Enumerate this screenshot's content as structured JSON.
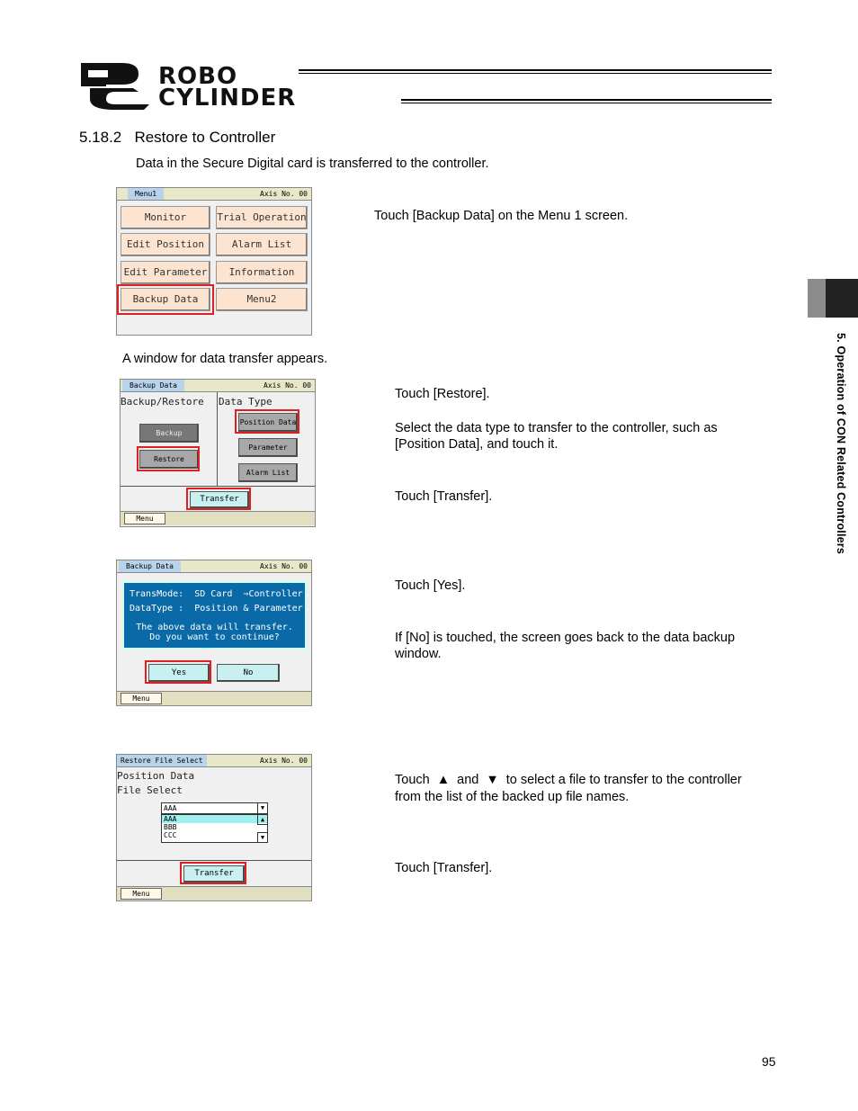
{
  "header": {
    "logo_line1": "ROBO",
    "logo_line2": "CYLINDER"
  },
  "section": {
    "number": "5.18.2",
    "title": "Restore to Controller",
    "intro": "Data in the Secure Digital card is transferred to the controller."
  },
  "side_tab": "5. Operation of CON Related Controllers",
  "screen1": {
    "title": "Menu1",
    "axis": "Axis No. 00",
    "buttons": [
      "Monitor",
      "Trial Operation",
      "Edit Position",
      "Alarm List",
      "Edit Parameter",
      "Information",
      "Backup Data",
      "Menu2"
    ]
  },
  "step1": "Touch [Backup Data] on the Menu 1 screen.",
  "window_note": "A window for data transfer appears.",
  "screen2": {
    "title": "Backup Data",
    "axis": "Axis No. 00",
    "left_label": "Backup/Restore",
    "right_label": "Data Type",
    "backup": "Backup",
    "restore": "Restore",
    "position_data": "Position Data",
    "parameter": "Parameter",
    "alarm_list": "Alarm List",
    "transfer": "Transfer",
    "menu": "Menu"
  },
  "step2a": "Touch [Restore].",
  "step2b": "Select the data type to transfer to the controller, such as [Position Data], and touch it.",
  "step2c": "Touch [Transfer].",
  "screen3": {
    "title": "Backup Data",
    "axis": "Axis No. 00",
    "line1": "TransMode:  SD Card  ⇒Controller",
    "line2": "DataType :  Position & Parameter",
    "line3": "The above data will transfer.",
    "line4": "Do you want to continue?",
    "yes": "Yes",
    "no": "No",
    "menu": "Menu"
  },
  "step3a": "Touch [Yes].",
  "step3b": "If [No] is touched, the screen goes back to the data backup window.",
  "screen4": {
    "title": "Restore File Select",
    "axis": "Axis No. 00",
    "line1": "Position Data",
    "line2": "File Select",
    "selected": "AAA",
    "files": [
      "AAA",
      "BBB",
      "CCC"
    ],
    "transfer": "Transfer",
    "menu": "Menu"
  },
  "step4a_pre": "Touch",
  "step4a_and": "and",
  "step4a_post": "to select a file to transfer to the controller",
  "step4a_line2": "from the list of the backed up file names.",
  "step4b": "Touch [Transfer].",
  "page_number": "95"
}
